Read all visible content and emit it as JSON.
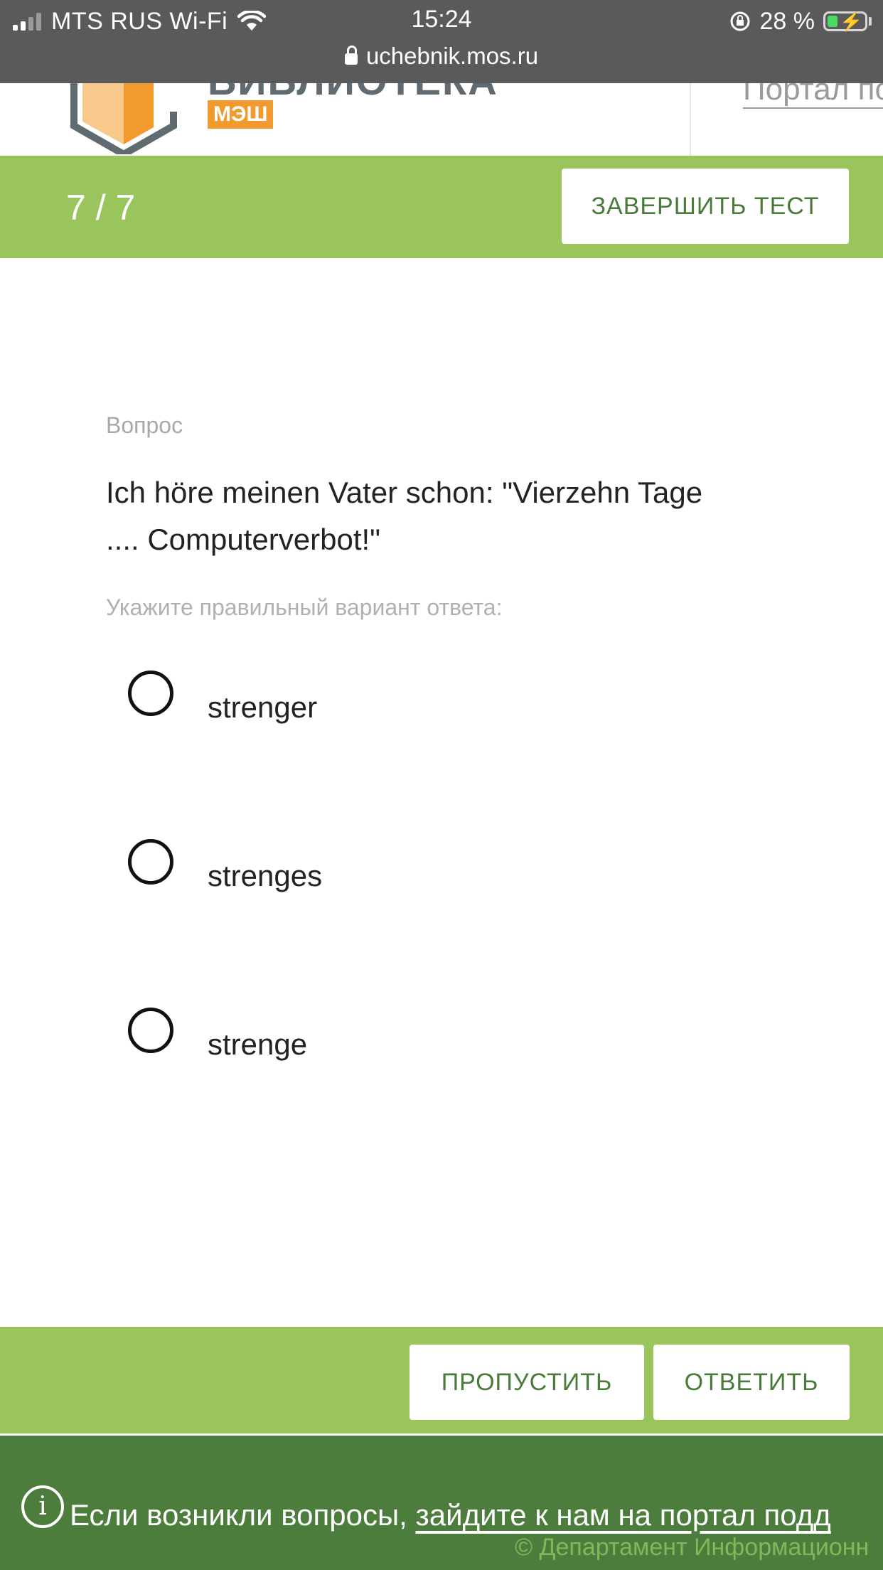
{
  "status_bar": {
    "carrier": "MTS RUS Wi-Fi",
    "time": "15:24",
    "battery": "28 %",
    "battery_level": 0.28,
    "url": "uchebnik.mos.ru"
  },
  "header": {
    "brand_top": "БИБЛИОТЕКА",
    "brand_badge": "МЭШ",
    "portal_link": "Портал по"
  },
  "progress": {
    "counter": "7 / 7",
    "finish_label": "ЗАВЕРШИТЬ ТЕСТ"
  },
  "question": {
    "label": "Вопрос",
    "text_line1": "Ich höre meinen Vater schon: \"Vierzehn Tage",
    "text_line2": ".... Computerverbot!\"",
    "hint": "Укажите правильный вариант ответа:",
    "options": [
      {
        "label": "strenger",
        "selected": false
      },
      {
        "label": "strenges",
        "selected": false
      },
      {
        "label": "strenge",
        "selected": false
      }
    ]
  },
  "actions": {
    "skip_label": "ПРОПУСТИТЬ",
    "answer_label": "ОТВЕТИТЬ"
  },
  "footer": {
    "text": "Если возникли вопросы, ",
    "link": "зайдите к нам на портал подд",
    "copyright": "© Департамент Информационн"
  },
  "colors": {
    "accent_green": "#9ac45c",
    "footer_green": "#4d7d3c",
    "button_text": "#4a7a3a",
    "brand_orange": "#f39a2e"
  }
}
